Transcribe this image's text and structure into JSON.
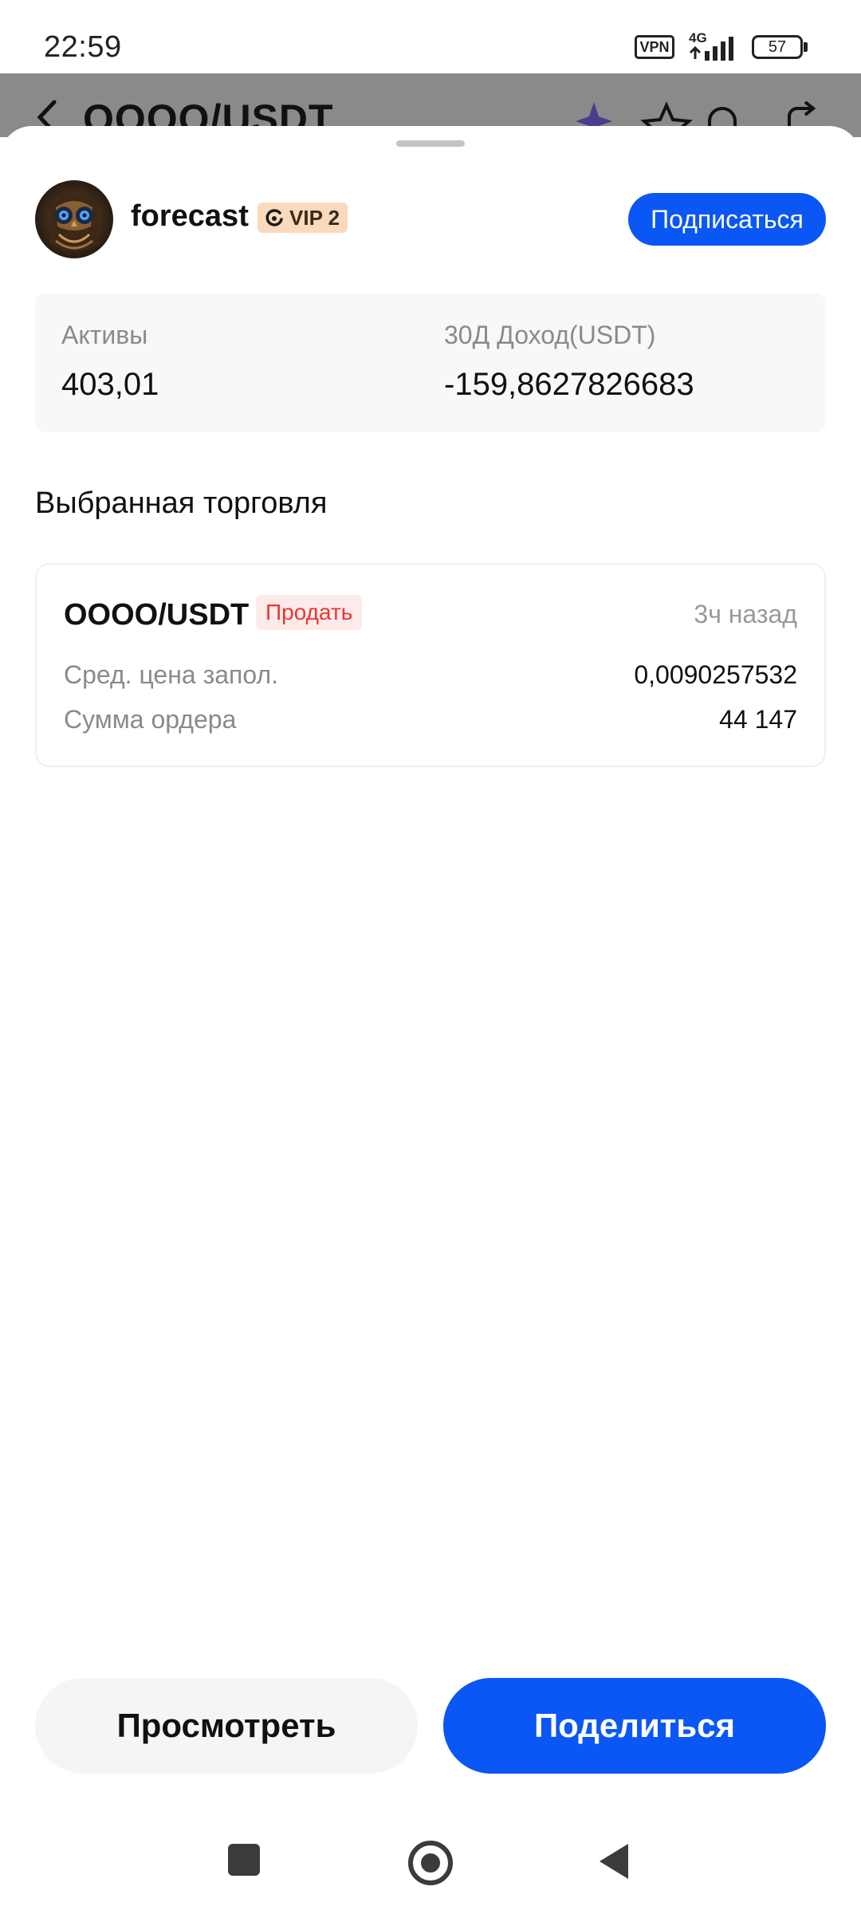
{
  "status_bar": {
    "time": "22:59",
    "vpn": "VPN",
    "network": "4G",
    "battery": "57"
  },
  "background_header": {
    "pair": "OOOO/USDT"
  },
  "profile": {
    "name": "forecast",
    "vip_label": "VIP 2",
    "subscribe_label": "Подписаться"
  },
  "stats": {
    "assets_label": "Активы",
    "assets_value": "403,01",
    "income_label": "30Д Доход(USDT)",
    "income_value": "-159,8627826683"
  },
  "section": {
    "title": "Выбранная торговля"
  },
  "trade": {
    "pair": "OOOO/USDT",
    "side": "Продать",
    "time_ago": "3ч назад",
    "avg_price_label": "Сред. цена запол.",
    "avg_price_value": "0,0090257532",
    "order_amount_label": "Сумма ордера",
    "order_amount_value": "44 147"
  },
  "actions": {
    "view_label": "Просмотреть",
    "share_label": "Поделиться"
  },
  "colors": {
    "accent": "#0b57f5",
    "sell": "#e53935",
    "vip_bg": "#fbd9bc"
  },
  "icons": [
    "back-icon",
    "sparkle-icon",
    "star-icon",
    "bell-icon",
    "share-icon",
    "vip-icon",
    "recent-apps-icon",
    "home-icon",
    "nav-back-icon"
  ]
}
